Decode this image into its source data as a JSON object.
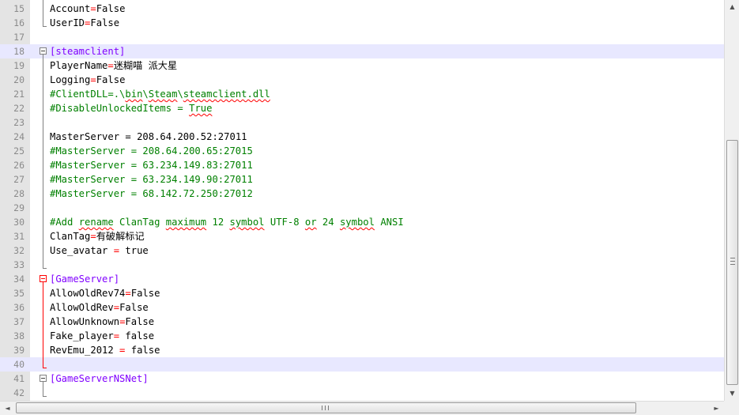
{
  "editor": {
    "lines": [
      {
        "num": "15",
        "tokens": [
          {
            "t": "Account",
            "c": "key"
          },
          {
            "t": "=",
            "c": "op"
          },
          {
            "t": "False",
            "c": "val"
          }
        ]
      },
      {
        "num": "16",
        "tokens": [
          {
            "t": "UserID",
            "c": "key"
          },
          {
            "t": "=",
            "c": "op"
          },
          {
            "t": "False",
            "c": "val"
          }
        ]
      },
      {
        "num": "17",
        "tokens": []
      },
      {
        "num": "18",
        "current": true,
        "tokens": [
          {
            "t": "[steamclient]",
            "c": "section"
          }
        ]
      },
      {
        "num": "19",
        "tokens": [
          {
            "t": "PlayerName",
            "c": "key"
          },
          {
            "t": "=",
            "c": "op"
          },
          {
            "t": "迷糊喵 派大星",
            "c": "val"
          }
        ]
      },
      {
        "num": "20",
        "tokens": [
          {
            "t": "Logging",
            "c": "key"
          },
          {
            "t": "=",
            "c": "op"
          },
          {
            "t": "False",
            "c": "val"
          }
        ]
      },
      {
        "num": "21",
        "tokens": [
          {
            "t": "#ClientDLL=.\\",
            "c": "comment"
          },
          {
            "t": "bin",
            "c": "comment",
            "sq": true
          },
          {
            "t": "\\",
            "c": "comment"
          },
          {
            "t": "Steam",
            "c": "comment",
            "sq": true
          },
          {
            "t": "\\",
            "c": "comment"
          },
          {
            "t": "steamclient.dll",
            "c": "comment",
            "sq": true
          }
        ]
      },
      {
        "num": "22",
        "tokens": [
          {
            "t": "#DisableUnlockedItems = ",
            "c": "comment"
          },
          {
            "t": "True",
            "c": "comment",
            "sq": true
          }
        ]
      },
      {
        "num": "23",
        "tokens": []
      },
      {
        "num": "24",
        "tokens": [
          {
            "t": "MasterServer",
            "c": "key"
          },
          {
            "t": " = ",
            "c": "plain"
          },
          {
            "t": "208.64.200.52:27011",
            "c": "val"
          }
        ]
      },
      {
        "num": "25",
        "tokens": [
          {
            "t": "#MasterServer = 208.64.200.65:27015",
            "c": "comment"
          }
        ]
      },
      {
        "num": "26",
        "tokens": [
          {
            "t": "#MasterServer = 63.234.149.83:27011",
            "c": "comment"
          }
        ]
      },
      {
        "num": "27",
        "tokens": [
          {
            "t": "#MasterServer = 63.234.149.90:27011",
            "c": "comment"
          }
        ]
      },
      {
        "num": "28",
        "tokens": [
          {
            "t": "#MasterServer = 68.142.72.250:27012",
            "c": "comment"
          }
        ]
      },
      {
        "num": "29",
        "tokens": []
      },
      {
        "num": "30",
        "tokens": [
          {
            "t": "#Add ",
            "c": "comment"
          },
          {
            "t": "rename",
            "c": "comment",
            "sq": true
          },
          {
            "t": " ClanTag ",
            "c": "comment"
          },
          {
            "t": "maximum",
            "c": "comment",
            "sq": true
          },
          {
            "t": " 12 ",
            "c": "comment"
          },
          {
            "t": "symbol",
            "c": "comment",
            "sq": true
          },
          {
            "t": " UTF-8 ",
            "c": "comment"
          },
          {
            "t": "or",
            "c": "comment",
            "sq": true
          },
          {
            "t": " 24 ",
            "c": "comment"
          },
          {
            "t": "symbol",
            "c": "comment",
            "sq": true
          },
          {
            "t": " ANSI",
            "c": "comment"
          }
        ]
      },
      {
        "num": "31",
        "tokens": [
          {
            "t": "ClanTag",
            "c": "key"
          },
          {
            "t": "=",
            "c": "op"
          },
          {
            "t": "有破解标记",
            "c": "val"
          }
        ]
      },
      {
        "num": "32",
        "tokens": [
          {
            "t": "Use_avatar",
            "c": "key"
          },
          {
            "t": " = ",
            "c": "op"
          },
          {
            "t": "true",
            "c": "val"
          }
        ]
      },
      {
        "num": "33",
        "tokens": []
      },
      {
        "num": "34",
        "tokens": [
          {
            "t": "[GameServer]",
            "c": "section"
          }
        ]
      },
      {
        "num": "35",
        "tokens": [
          {
            "t": "AllowOldRev74",
            "c": "key"
          },
          {
            "t": "=",
            "c": "op"
          },
          {
            "t": "False",
            "c": "val"
          }
        ]
      },
      {
        "num": "36",
        "tokens": [
          {
            "t": "AllowOldRev",
            "c": "key"
          },
          {
            "t": "=",
            "c": "op"
          },
          {
            "t": "False",
            "c": "val"
          }
        ]
      },
      {
        "num": "37",
        "tokens": [
          {
            "t": "AllowUnknown",
            "c": "key"
          },
          {
            "t": "=",
            "c": "op"
          },
          {
            "t": "False",
            "c": "val"
          }
        ]
      },
      {
        "num": "38",
        "tokens": [
          {
            "t": "Fake_player",
            "c": "key"
          },
          {
            "t": "=",
            "c": "op"
          },
          {
            "t": " false",
            "c": "val"
          }
        ]
      },
      {
        "num": "39",
        "tokens": [
          {
            "t": "RevEmu_2012",
            "c": "key"
          },
          {
            "t": " = ",
            "c": "op"
          },
          {
            "t": "false",
            "c": "val"
          }
        ]
      },
      {
        "num": "40",
        "current": true,
        "tokens": []
      },
      {
        "num": "41",
        "tokens": [
          {
            "t": "[GameServerNSNet]",
            "c": "section"
          }
        ]
      },
      {
        "num": "42",
        "tokens": []
      }
    ]
  },
  "scrollbars": {
    "up_arrow": "▲",
    "down_arrow": "▼",
    "left_arrow": "◄",
    "right_arrow": "►"
  },
  "colors": {
    "section": "#8000ff",
    "comment": "#008000",
    "operator": "#ff0000",
    "current_line": "#e8e8ff",
    "fold_active": "#ff0000"
  }
}
